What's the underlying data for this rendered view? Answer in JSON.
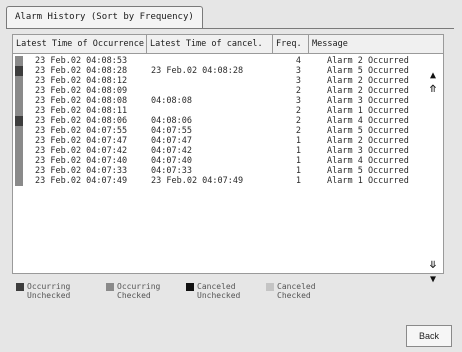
{
  "tab": {
    "label": "Alarm History (Sort by Frequency)"
  },
  "table": {
    "headers": {
      "occurrence": "Latest Time of Occurrence",
      "cancel": "Latest Time of cancel.",
      "freq": "Freq.",
      "message": "Message"
    },
    "rows": [
      {
        "state": "occurring_checked",
        "occurred": "23 Feb.02 04:08:53",
        "canceled": "",
        "freq": "4",
        "message": "Alarm 2 Occurred"
      },
      {
        "state": "occurring_unchecked",
        "occurred": "23 Feb.02 04:08:28",
        "canceled": "23 Feb.02 04:08:28",
        "freq": "3",
        "message": "Alarm 5 Occurred"
      },
      {
        "state": "occurring_checked",
        "occurred": "23 Feb.02 04:08:12",
        "canceled": "",
        "freq": "3",
        "message": "Alarm 2 Occurred"
      },
      {
        "state": "occurring_checked",
        "occurred": "23 Feb.02 04:08:09",
        "canceled": "",
        "freq": "2",
        "message": "Alarm 2 Occurred"
      },
      {
        "state": "occurring_checked",
        "occurred": "23 Feb.02 04:08:08",
        "canceled": "04:08:08",
        "freq": "3",
        "message": "Alarm 3 Occurred"
      },
      {
        "state": "occurring_checked",
        "occurred": "23 Feb.02 04:08:11",
        "canceled": "",
        "freq": "2",
        "message": "Alarm 1 Occurred"
      },
      {
        "state": "occurring_unchecked",
        "occurred": "23 Feb.02 04:08:06",
        "canceled": "04:08:06",
        "freq": "2",
        "message": "Alarm 4 Occurred"
      },
      {
        "state": "occurring_checked",
        "occurred": "23 Feb.02 04:07:55",
        "canceled": "04:07:55",
        "freq": "2",
        "message": "Alarm 5 Occurred"
      },
      {
        "state": "occurring_checked",
        "occurred": "23 Feb.02 04:07:47",
        "canceled": "04:07:47",
        "freq": "1",
        "message": "Alarm 2 Occurred"
      },
      {
        "state": "occurring_checked",
        "occurred": "23 Feb.02 04:07:42",
        "canceled": "04:07:42",
        "freq": "1",
        "message": "Alarm 3 Occurred"
      },
      {
        "state": "occurring_checked",
        "occurred": "23 Feb.02 04:07:40",
        "canceled": "04:07:40",
        "freq": "1",
        "message": "Alarm 4 Occurred"
      },
      {
        "state": "occurring_checked",
        "occurred": "23 Feb.02 04:07:33",
        "canceled": "04:07:33",
        "freq": "1",
        "message": "Alarm 5 Occurred"
      },
      {
        "state": "occurring_checked",
        "occurred": "23 Feb.02 04:07:49",
        "canceled": "23 Feb.02 04:07:49",
        "freq": "1",
        "message": "Alarm 1 Occurred"
      }
    ]
  },
  "scroll": {
    "up_icon": "triangle-up-icon",
    "page_up_icon": "double-chevron-up-icon",
    "page_down_icon": "double-chevron-down-icon",
    "down_icon": "triangle-down-icon"
  },
  "legend": [
    {
      "state": "occurring_unchecked",
      "label1": "Occurring",
      "label2": "Unchecked"
    },
    {
      "state": "occurring_checked",
      "label1": "Occurring",
      "label2": "Checked"
    },
    {
      "state": "canceled_unchecked",
      "label1": "Canceled",
      "label2": "Unchecked"
    },
    {
      "state": "canceled_checked",
      "label1": "Canceled",
      "label2": "Checked"
    }
  ],
  "colors": {
    "occurring_unchecked": "#3d3d3d",
    "occurring_checked": "#8a8a8a",
    "canceled_unchecked": "#111111",
    "canceled_checked": "#c4c4c4",
    "text_row": "#2a2a2a"
  },
  "buttons": {
    "back": "Back"
  }
}
